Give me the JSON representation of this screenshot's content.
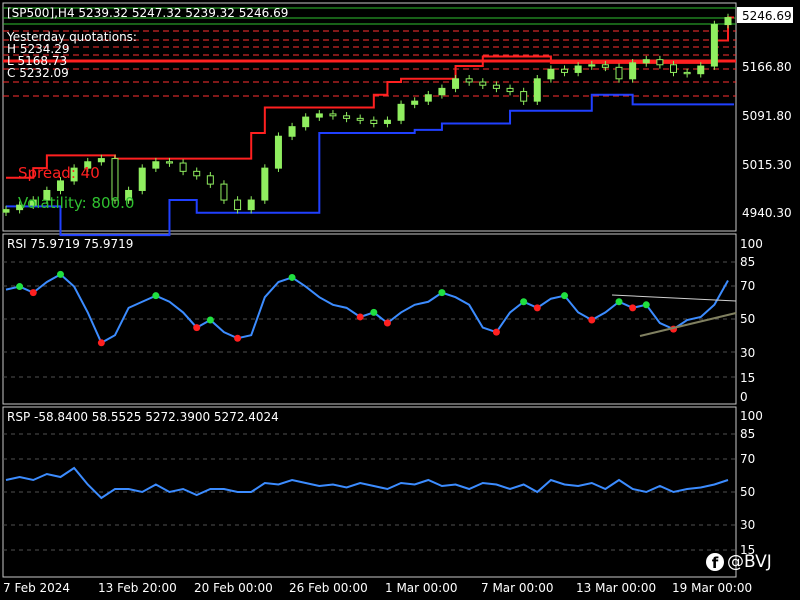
{
  "main": {
    "header": "[SP500],H4  5239.32 5247.32 5239.32 5246.69",
    "yesterday_title": "Yesterday quotations:",
    "yesterday_high": "H 5234.29",
    "yesterday_low": "L 5168.73",
    "yesterday_close": "C 5232.09",
    "spread": "Spread: 40",
    "volatility": "Volatility: 800.0",
    "price_tag": "5246.69",
    "price_ticks": [
      "5166.80",
      "5091.80",
      "5015.30",
      "4940.30"
    ]
  },
  "rsi": {
    "header": "RSI 75.9719 75.9719",
    "ticks": [
      "100",
      "85",
      "70",
      "50",
      "30",
      "15",
      "0"
    ]
  },
  "rsp": {
    "header": "RSP -58.8400 58.5525 5272.3900 5272.4024",
    "ticks": [
      "100",
      "85",
      "70",
      "50",
      "30",
      "15"
    ]
  },
  "time_axis": [
    "7 Feb 2024",
    "13 Feb 20:00",
    "20 Feb 00:00",
    "26 Feb 00:00",
    "1 Mar 00:00",
    "7 Mar 00:00",
    "13 Mar 00:00",
    "19 Mar 00:00"
  ],
  "watermark": "@BVJ",
  "colors": {
    "candle": "#90ee60",
    "upper_band": "#ff2020",
    "lower_band": "#2040ff",
    "rsi_line": "#3c8cff",
    "ob_dot": "#20e040",
    "os_dot": "#ff2020",
    "yesterday_line": "#ff2020"
  },
  "chart_data": [
    {
      "type": "line",
      "title": "[SP500],H4",
      "series": [
        {
          "values": [
            4945,
            4952,
            4960,
            4975,
            4990,
            5010,
            5020,
            5025,
            4960,
            4975,
            5010,
            5020,
            5018,
            5005,
            4998,
            4985,
            4960,
            4945,
            4960,
            5010,
            5060,
            5075,
            5090,
            5095,
            5092,
            5088,
            5085,
            5080,
            5085,
            5110,
            5115,
            5125,
            5135,
            5150,
            5145,
            5140,
            5135,
            5130,
            5115,
            5150,
            5165,
            5160,
            5170,
            5172,
            5168,
            5150,
            5175,
            5180,
            5172,
            5160,
            5158,
            5170,
            5235,
            5246
          ]
        },
        {
          "values": [
            4950,
            4950,
            4950,
            4950,
            4905,
            4905,
            4905,
            4905,
            4905,
            4905,
            4905,
            4905,
            4960,
            4960,
            4940,
            4940,
            4940,
            4940,
            4940,
            4940,
            4940,
            4940,
            4940,
            5065,
            5065,
            5065,
            5065,
            5065,
            5065,
            5065,
            5070,
            5070,
            5080,
            5080,
            5080,
            5080,
            5080,
            5100,
            5100,
            5100,
            5100,
            5100,
            5100,
            5125,
            5125,
            5125,
            5110,
            5110,
            5110,
            5110,
            5110,
            5110,
            5110,
            5110
          ]
        },
        {
          "values": [
            4995,
            4995,
            5010,
            5030,
            5030,
            5030,
            5030,
            5030,
            5025,
            5025,
            5025,
            5025,
            5025,
            5025,
            5025,
            5025,
            5025,
            5025,
            5065,
            5105,
            5105,
            5105,
            5105,
            5105,
            5105,
            5105,
            5105,
            5125,
            5145,
            5150,
            5150,
            5150,
            5150,
            5170,
            5170,
            5185,
            5185,
            5185,
            5185,
            5185,
            5175,
            5175,
            5175,
            5175,
            5175,
            5175,
            5175,
            5175,
            5175,
            5175,
            5175,
            5175,
            5210,
            5246
          ]
        }
      ]
    },
    {
      "type": "line",
      "title": "RSI 75.9719 75.9719",
      "ylim": [
        0,
        100
      ],
      "series": [
        {
          "values": [
            70,
            72,
            68,
            75,
            80,
            72,
            55,
            35,
            40,
            58,
            62,
            66,
            62,
            55,
            45,
            50,
            42,
            38,
            40,
            65,
            75,
            78,
            72,
            65,
            60,
            58,
            52,
            55,
            48,
            55,
            60,
            62,
            68,
            65,
            60,
            45,
            42,
            55,
            62,
            58,
            64,
            66,
            55,
            50,
            55,
            62,
            58,
            60,
            48,
            44,
            50,
            52,
            60,
            76
          ]
        }
      ]
    },
    {
      "type": "line",
      "title": "RSP -58.8400 58.5525 5272.3900 5272.4024",
      "ylim": [
        0,
        100
      ],
      "series": [
        {
          "values": [
            58,
            60,
            58,
            62,
            60,
            66,
            55,
            46,
            52,
            52,
            50,
            55,
            50,
            52,
            48,
            52,
            52,
            50,
            50,
            56,
            55,
            58,
            56,
            54,
            55,
            53,
            56,
            54,
            52,
            56,
            55,
            58,
            54,
            55,
            52,
            56,
            55,
            52,
            55,
            50,
            58,
            55,
            54,
            56,
            52,
            58,
            52,
            50,
            54,
            50,
            52,
            53,
            55,
            58
          ]
        }
      ]
    }
  ]
}
